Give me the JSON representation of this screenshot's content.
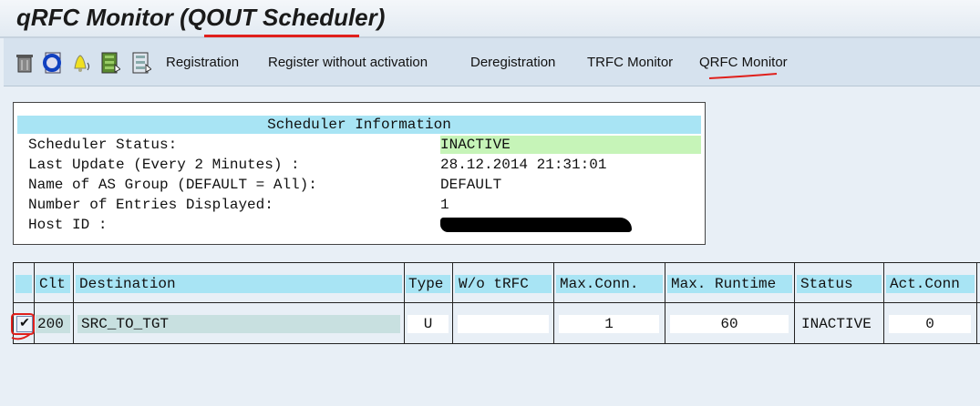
{
  "title": "qRFC Monitor (QOUT Scheduler)",
  "toolbar": {
    "icons": [
      "trash-icon",
      "refresh-icon",
      "bell-icon",
      "details-green-icon",
      "details-icon"
    ],
    "buttons": [
      "Registration",
      "Register without activation",
      "Deregistration",
      "TRFC Monitor",
      "QRFC Monitor"
    ]
  },
  "scheduler_info": {
    "heading": "Scheduler Information",
    "rows": [
      {
        "label": "Scheduler Status:",
        "value": "INACTIVE"
      },
      {
        "label": "Last Update (Every 2 Minutes)  :",
        "value": "28.12.2014 21:31:01"
      },
      {
        "label": "Name of AS Group (DEFAULT = All):",
        "value": "DEFAULT"
      },
      {
        "label": "Number of Entries Displayed:",
        "value": "1"
      },
      {
        "label": "Host ID :",
        "value": ""
      }
    ],
    "status_color": "#c6f4b8"
  },
  "table": {
    "headers": [
      "Clt",
      "Destination",
      "Type",
      "W/o tRFC",
      "Max.Conn.",
      "Max. Runtime",
      "Status",
      "Act.Conn"
    ],
    "rows": [
      {
        "selected": true,
        "clt": "200",
        "destination": "SRC_TO_TGT",
        "type": "U",
        "wo_trfc": "",
        "max_conn": "1",
        "max_runtime": "60",
        "status": "INACTIVE",
        "act_conn": "0"
      }
    ]
  }
}
